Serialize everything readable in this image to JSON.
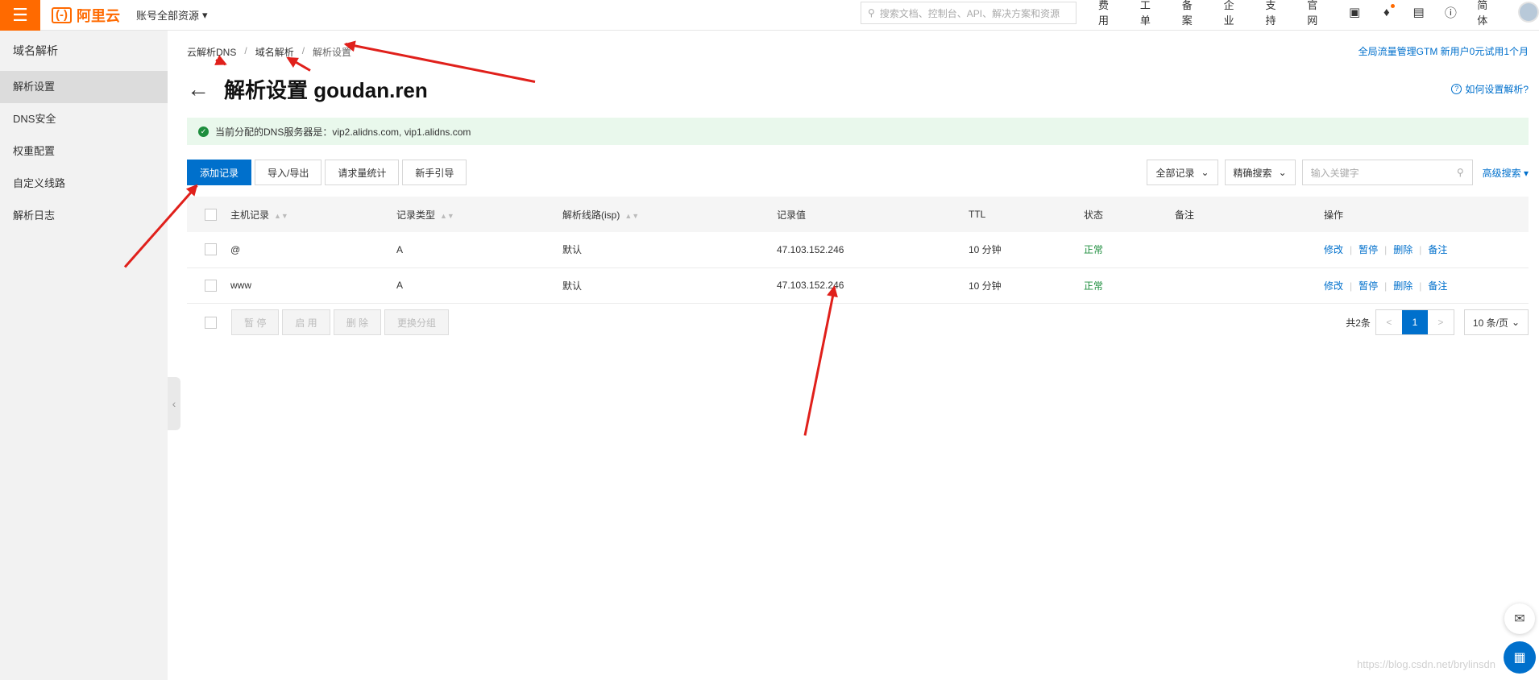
{
  "topbar": {
    "menu_icon": "hamburger-icon",
    "logo_mark": "(-)",
    "logo_text": "阿里云",
    "account": "账号全部资源",
    "search_placeholder": "搜索文档、控制台、API、解决方案和资源",
    "nav": [
      "费用",
      "工单",
      "备案",
      "企业",
      "支持",
      "官网"
    ],
    "lang": "简体"
  },
  "sidebar": {
    "title": "域名解析",
    "items": [
      "解析设置",
      "DNS安全",
      "权重配置",
      "自定义线路",
      "解析日志"
    ]
  },
  "breadcrumb": [
    "云解析DNS",
    "域名解析",
    "解析设置"
  ],
  "promo": "全局流量管理GTM 新用户0元试用1个月",
  "page_title": "解析设置 goudan.ren",
  "howto": "如何设置解析?",
  "notice": "当前分配的DNS服务器是：vip2.alidns.com, vip1.alidns.com",
  "toolbar": [
    "添加记录",
    "导入/导出",
    "请求量统计",
    "新手引导"
  ],
  "filters": {
    "record_select": "全部记录",
    "search_mode": "精确搜索",
    "keyword_placeholder": "输入关键字",
    "advanced": "高级搜索"
  },
  "table": {
    "headers": [
      "主机记录",
      "记录类型",
      "解析线路(isp)",
      "记录值",
      "TTL",
      "状态",
      "备注",
      "操作"
    ],
    "rows": [
      {
        "host": "@",
        "type": "A",
        "line": "默认",
        "value": "47.103.152.246",
        "ttl": "10 分钟",
        "status": "正常",
        "remark": ""
      },
      {
        "host": "www",
        "type": "A",
        "line": "默认",
        "value": "47.103.152.246",
        "ttl": "10 分钟",
        "status": "正常",
        "remark": ""
      }
    ],
    "ops": [
      "修改",
      "暂停",
      "删除",
      "备注"
    ]
  },
  "bulk": [
    "暂 停",
    "启 用",
    "删 除",
    "更换分组"
  ],
  "pager": {
    "total": "共2条",
    "prev": "<",
    "current": "1",
    "next": ">",
    "per_page": "10 条/页"
  },
  "watermark": "https://blog.csdn.net/brylinsdn",
  "colors": {
    "accent": "#ff6a00",
    "primary": "#0070cc",
    "success": "#1e8e3e",
    "annotation": "#e0201b"
  }
}
